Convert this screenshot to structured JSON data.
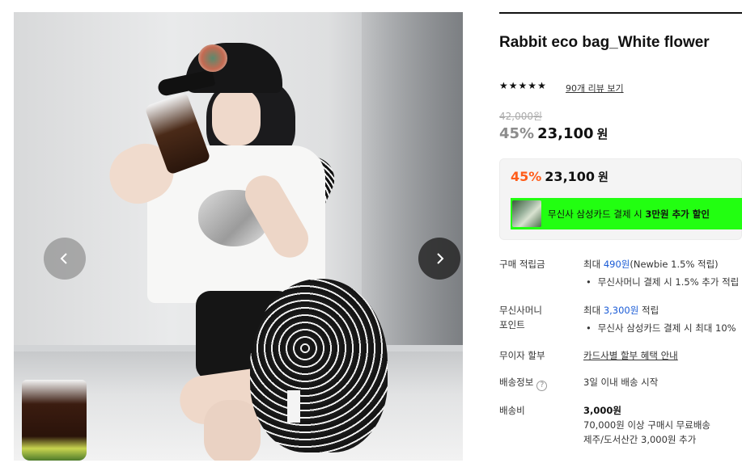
{
  "product": {
    "title": "Rabbit eco bag_White flower",
    "rating_stars": 5,
    "review_link": "90개 리뷰 보기",
    "original_price": "42,000원",
    "discount_pct": "45%",
    "price": "23,100",
    "price_unit": "원"
  },
  "promo": {
    "discount_pct": "45%",
    "price": "23,100",
    "price_unit": "원",
    "card_text_prefix": "무신사 삼성카드 결제 시 ",
    "card_text_bold": "3만원 추가 할인"
  },
  "gallery": {
    "prev_icon": "chevron-left-icon",
    "next_icon": "chevron-right-icon"
  },
  "details": {
    "points": {
      "label": "구매 적립금",
      "prefix": "최대 ",
      "amount": "490원",
      "suffix": "(Newbie 1.5% 적립)",
      "bullet": "무신사머니 결제 시 1.5% 추가 적립"
    },
    "musinsa_points": {
      "label_line1": "무신사머니",
      "label_line2": "포인트",
      "prefix": "최대 ",
      "amount": "3,300원",
      "suffix": " 적립",
      "bullet": "무신사 삼성카드 결제 시 최대 10%"
    },
    "installment": {
      "label": "무이자 할부",
      "link": "카드사별 할부 혜택 안내"
    },
    "shipping_info": {
      "label": "배송정보",
      "value": "3일 이내 배송 시작"
    },
    "shipping_fee": {
      "label": "배송비",
      "value": "3,000원",
      "line2": "70,000원 이상 구매시 무료배송",
      "line3": "제주/도서산간 3,000원 추가"
    }
  },
  "colors": {
    "accent_orange": "#ff5d1a",
    "card_banner_green": "#22ff11",
    "link_blue": "#1a5bd6"
  }
}
